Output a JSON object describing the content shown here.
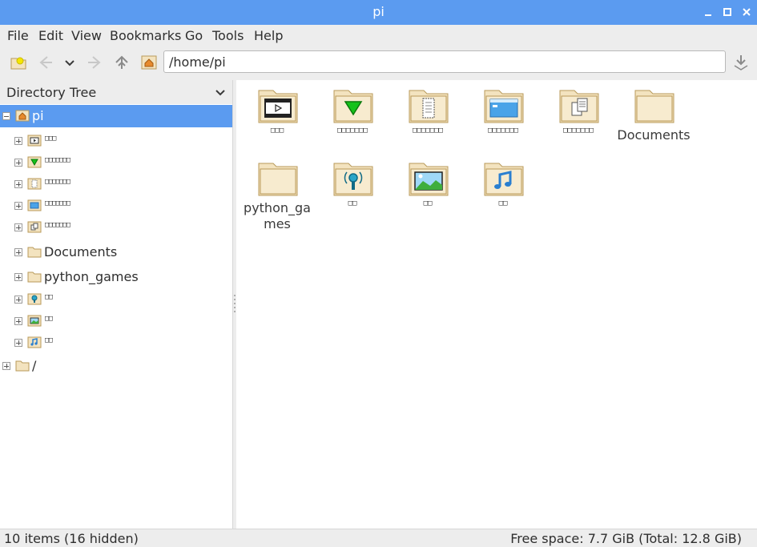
{
  "window": {
    "title": "pi"
  },
  "menu": [
    "File",
    "Edit",
    "View",
    "Bookmarks",
    "Go",
    "Tools",
    "Help"
  ],
  "toolbar": {
    "path": "/home/pi"
  },
  "sidebar": {
    "header": "Directory Tree",
    "root": "pi",
    "children": [
      {
        "label": "□□□",
        "icon": "video-icon"
      },
      {
        "label": "□□□□□□□",
        "icon": "download-icon"
      },
      {
        "label": "□□□□□□□",
        "icon": "document-icon"
      },
      {
        "label": "□□□□□□□",
        "icon": "desktop-icon"
      },
      {
        "label": "□□□□□□□",
        "icon": "templates-icon"
      },
      {
        "label": "Documents",
        "icon": "folder-icon"
      },
      {
        "label": "python_games",
        "icon": "folder-icon"
      },
      {
        "label": "□□",
        "icon": "podcast-icon"
      },
      {
        "label": "□□",
        "icon": "picture-icon"
      },
      {
        "label": "□□",
        "icon": "music-icon"
      }
    ],
    "fsroot": "/"
  },
  "files": [
    {
      "label": "□□□",
      "kind": "video"
    },
    {
      "label": "□□□□□□□",
      "kind": "download"
    },
    {
      "label": "□□□□□□□",
      "kind": "document"
    },
    {
      "label": "□□□□□□□",
      "kind": "desktop"
    },
    {
      "label": "□□□□□□□",
      "kind": "templates"
    },
    {
      "label": "Documents",
      "kind": "folder"
    },
    {
      "label": "python_games",
      "kind": "folder"
    },
    {
      "label": "□□",
      "kind": "podcast"
    },
    {
      "label": "□□",
      "kind": "picture"
    },
    {
      "label": "□□",
      "kind": "music"
    }
  ],
  "status": {
    "items": "10 items (16 hidden)",
    "free": "Free space: 7.7 GiB (Total: 12.8 GiB)"
  },
  "colors": {
    "accent": "#5b9bf0",
    "folder": "#f3e3bf",
    "folder_edge": "#b89a5a"
  }
}
